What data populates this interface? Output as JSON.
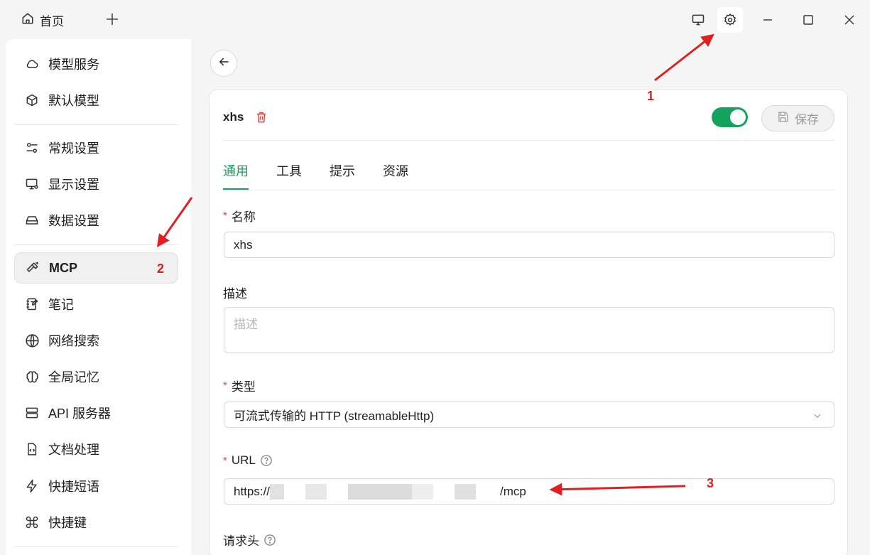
{
  "titlebar": {
    "home_tab_label": "首页"
  },
  "sidebar": {
    "items": [
      {
        "label": "模型服务",
        "icon": "cloud-icon"
      },
      {
        "label": "默认模型",
        "icon": "cube-icon"
      },
      {
        "label": "常规设置",
        "icon": "sliders-icon"
      },
      {
        "label": "显示设置",
        "icon": "monitor-settings-icon"
      },
      {
        "label": "数据设置",
        "icon": "hard-drive-icon"
      },
      {
        "label": "MCP",
        "icon": "hammer-icon"
      },
      {
        "label": "笔记",
        "icon": "notebook-icon"
      },
      {
        "label": "网络搜索",
        "icon": "globe-icon"
      },
      {
        "label": "全局记忆",
        "icon": "brain-icon"
      },
      {
        "label": "API 服务器",
        "icon": "server-icon"
      },
      {
        "label": "文档处理",
        "icon": "file-code-icon"
      },
      {
        "label": "快捷短语",
        "icon": "zap-icon"
      },
      {
        "label": "快捷键",
        "icon": "command-icon"
      }
    ]
  },
  "server": {
    "name": "xhs",
    "enabled": true,
    "save_label": "保存"
  },
  "tabs": [
    "通用",
    "工具",
    "提示",
    "资源"
  ],
  "form": {
    "name_label": "名称",
    "name_value": "xhs",
    "desc_label": "描述",
    "desc_placeholder": "描述",
    "type_label": "类型",
    "type_value": "可流式传输的 HTTP (streamableHttp)",
    "url_label": "URL",
    "url_prefix": "https://",
    "url_suffix": "/mcp",
    "headers_label": "请求头",
    "required_mark": "*"
  },
  "annotations": {
    "n1": "1",
    "n2": "2",
    "n3": "3"
  },
  "colors": {
    "accent": "#14a35a",
    "annotation": "#e02020",
    "danger": "#e04848"
  }
}
